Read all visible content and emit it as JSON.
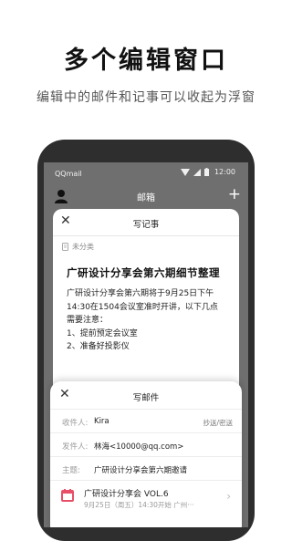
{
  "hero": {
    "title": "多个编辑窗口",
    "subtitle": "编辑中的邮件和记事可以收起为浮窗"
  },
  "status_bar": {
    "carrier": "QQmail",
    "time": "12:00"
  },
  "app_bar": {
    "title": "邮箱",
    "add_label": "+"
  },
  "note_card": {
    "close_label": "✕",
    "title": "写记事",
    "category": "未分类",
    "note_title": "广研设计分享会第六期细节整理",
    "body_lines": [
      "广研设计分享会第六期将于9月25日下午",
      "14:30在1504会议室准时开讲，以下几点",
      "需要注意：",
      "1、提前预定会议室",
      "2、准备好投影仪"
    ]
  },
  "mail_card": {
    "close_label": "✕",
    "title": "写邮件",
    "to_label": "收件人:",
    "to_value": "Kira",
    "cc_label": "抄送/密送",
    "from_label": "发件人:",
    "from_value": "林海<10000@qq.com>",
    "subject_label": "主题:",
    "subject_value": "广研设计分享会第六期邀请",
    "attachment": {
      "title": "广研设计分享会 VOL.6",
      "detail": "9月25日（周五）14:30开始   广州···"
    }
  },
  "colors": {
    "phone_body": "#2e2e2e",
    "screen_dim": "#6f6f6f",
    "calendar_accent": "#e8506a"
  }
}
